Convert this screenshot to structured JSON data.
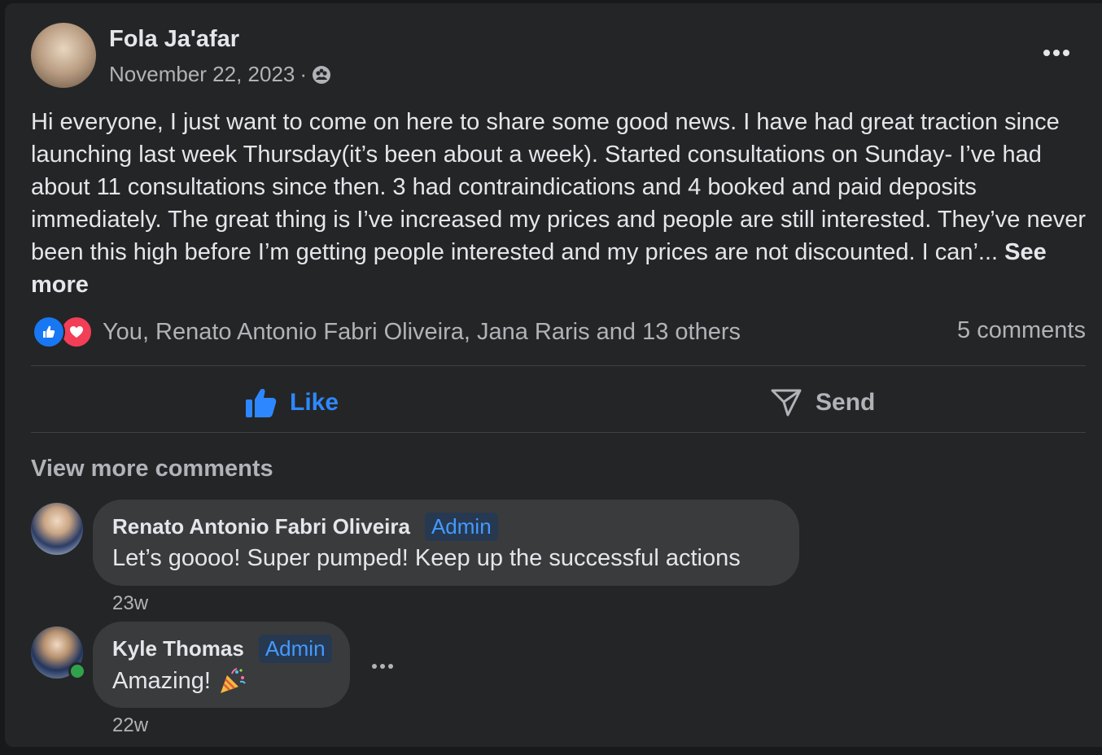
{
  "post": {
    "author": "Fola Ja'afar",
    "date": "November 22, 2023",
    "separator": "·",
    "privacy_icon": "group-icon",
    "body": "Hi everyone, I just want to come on here to share some good news. I have had great traction since launching last week Thursday(it’s been about a week). Started consultations on Sunday- I’ve had about 11 consultations since then. 3 had contraindications and 4 booked and paid deposits immediately. The great thing is I’ve increased my prices and people are still interested. They’ve never been this high before I’m getting people interested and my prices are not discounted. I can’...",
    "see_more": "See more",
    "reactions_text": "You, Renato Antonio Fabri Oliveira, Jana Raris and 13 others",
    "comments_count": "5 comments"
  },
  "actions": {
    "like": "Like",
    "send": "Send"
  },
  "view_more_comments": "View more comments",
  "comments": [
    {
      "name": "Renato Antonio Fabri Oliveira",
      "badge": "Admin",
      "text": "Let’s goooo! Super pumped! Keep up the successful actions",
      "time": "23w"
    },
    {
      "name": "Kyle Thomas",
      "badge": "Admin",
      "text": "Amazing!",
      "time": "22w"
    }
  ],
  "colors": {
    "background": "#18191a",
    "card": "#242526",
    "bubble": "#3a3b3c",
    "accent": "#2d88ff",
    "admin_badge_text": "#4599ff",
    "love": "#f33e58",
    "online": "#31a24c"
  }
}
